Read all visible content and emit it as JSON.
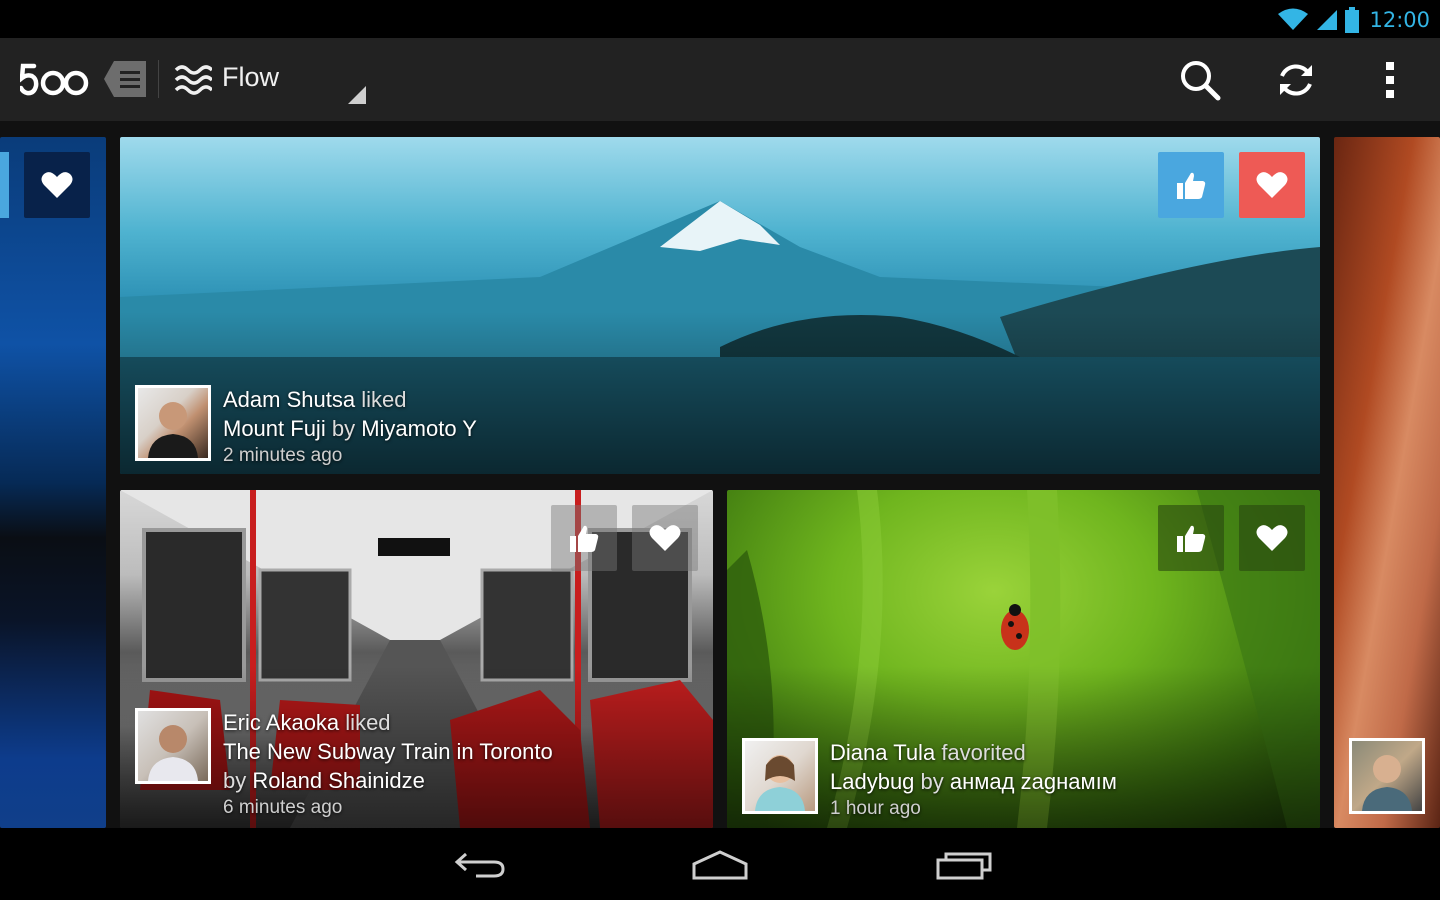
{
  "status_bar": {
    "time": "12:00",
    "icons": [
      "wifi-icon",
      "cell-signal-icon",
      "battery-icon"
    ]
  },
  "action_bar": {
    "logo_text": "500",
    "nav_title": "Flow",
    "actions": [
      "search-icon",
      "refresh-icon",
      "overflow-menu-icon"
    ]
  },
  "colors": {
    "accent": "#33b5e5",
    "like_blue": "#4aa7df",
    "favorite_red": "#ee5a55",
    "action_bar": "#222222"
  },
  "feed": [
    {
      "user": "Adam Shutsa",
      "verb": "liked",
      "photo_title": "Mount Fuji",
      "by_word": "by",
      "photographer": "Miyamoto Y",
      "time": "2 minutes ago",
      "liked": true,
      "favorited": true
    },
    {
      "user": "Eric Akaoka",
      "verb": "liked",
      "photo_title": "The New Subway Train in Toronto",
      "by_word": "by",
      "photographer": "Roland Shainidze",
      "time": "6 minutes ago",
      "liked": false,
      "favorited": false
    },
    {
      "user": "Diana Tula",
      "verb": "favorited",
      "photo_title": "Ladybug",
      "by_word": "by",
      "photographer": "анмад zagнамıм",
      "time": "1 hour ago",
      "liked": false,
      "favorited": false
    }
  ],
  "nav_bar": [
    "back-icon",
    "home-icon",
    "recent-apps-icon"
  ]
}
